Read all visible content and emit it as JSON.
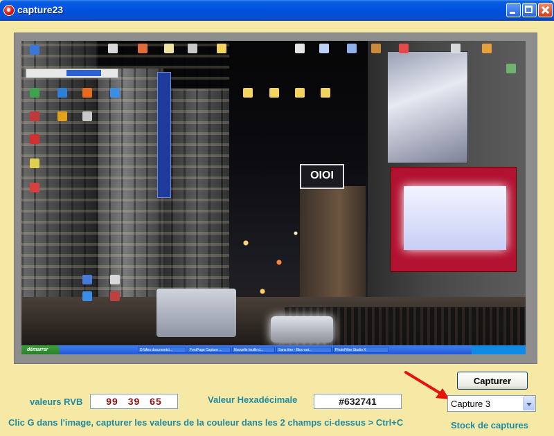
{
  "window": {
    "title": "capture23",
    "icon": "app-icon",
    "controls": [
      "minimize-icon",
      "maximize-icon",
      "close-icon"
    ]
  },
  "capture_preview": {
    "sign_text": "OIOI",
    "taskbar": {
      "start_label": "démarrer",
      "items": [
        "D:\\Mes documents\\...",
        "FontPage Capture ...",
        "Nouvelle feuille d...",
        "Sans titre - Bloc-not...",
        "PhotoFiltre Studio X"
      ]
    }
  },
  "buttons": {
    "capture_label": "Capturer"
  },
  "rvb": {
    "label": "valeurs RVB",
    "value": "99 39 65"
  },
  "hex": {
    "label": "Valeur Hexadécimale",
    "value": "#632741"
  },
  "help_text": "Clic G dans l'image, capturer les valeurs de la couleur dans les 2 champs ci-dessus > Ctrl+C",
  "stock": {
    "selected": "Capture 3",
    "label": "Stock de captures"
  },
  "colors": {
    "background": "#f6e9a6",
    "label_teal": "#1f8aa0",
    "rvb_text": "#8b0f0f",
    "arrow_red": "#e8120c"
  }
}
